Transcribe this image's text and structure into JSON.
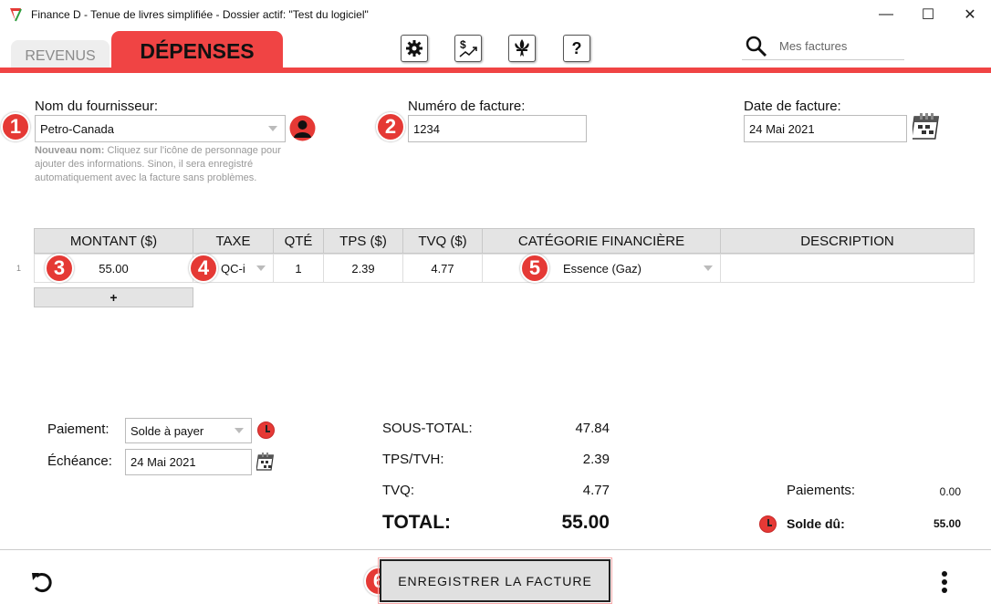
{
  "window": {
    "title": "Finance D - Tenue de livres simplifiée - Dossier actif: \"Test du logiciel\"",
    "minimize": "—",
    "maximize": "☐",
    "close": "✕"
  },
  "tabs": [
    {
      "label": "REVENUS",
      "active": false
    },
    {
      "label": "DÉPENSES",
      "active": true
    }
  ],
  "toolbar": {
    "icons": [
      "gear-icon",
      "dollar-chart-icon",
      "fleur-de-lis-icon",
      "help-icon"
    ],
    "help_label": "?",
    "dollar_label": "$"
  },
  "search": {
    "placeholder": "Mes factures"
  },
  "supplier": {
    "label": "Nom du fournisseur:",
    "value": "Petro-Canada",
    "hint_bold": "Nouveau nom:",
    "hint_line1": " Cliquez sur l'icône de personnage pour",
    "hint_line2": "ajouter des informations. Sinon, il sera enregistré",
    "hint_line3": "automatiquement avec la facture sans problèmes."
  },
  "invoice_number": {
    "label": "Numéro de facture:",
    "value": "1234"
  },
  "invoice_date": {
    "label": "Date de facture:",
    "value": "24 Mai 2021"
  },
  "badges": [
    "1",
    "2",
    "3",
    "4",
    "5",
    "6"
  ],
  "grid": {
    "headers": [
      "MONTANT ($)",
      "TAXE",
      "QTÉ",
      "TPS ($)",
      "TVQ ($)",
      "CATÉGORIE FINANCIÈRE",
      "DESCRIPTION"
    ],
    "row_number": "1",
    "row": {
      "montant": "55.00",
      "taxe": "QC-i",
      "qte": "1",
      "tps": "2.39",
      "tvq": "4.77",
      "categorie": "Essence (Gaz)",
      "description": ""
    },
    "add_label": "+"
  },
  "payment": {
    "label": "Paiement:",
    "value": "Solde à payer",
    "due_label": "Échéance:",
    "due_value": "24 Mai 2021"
  },
  "totals": {
    "subtotal_label": "SOUS-TOTAL:",
    "subtotal": "47.84",
    "tps_label": "TPS/TVH:",
    "tps": "2.39",
    "tvq_label": "TVQ:",
    "tvq": "4.77",
    "total_label": "TOTAL:",
    "total": "55.00",
    "payments_label": "Paiements:",
    "payments": "0.00",
    "balance_label": "Solde dû:",
    "balance": "55.00"
  },
  "footer": {
    "save_label": "ENREGISTRER LA FACTURE"
  },
  "colors": {
    "accent": "#f04444",
    "badge": "#e53935"
  }
}
